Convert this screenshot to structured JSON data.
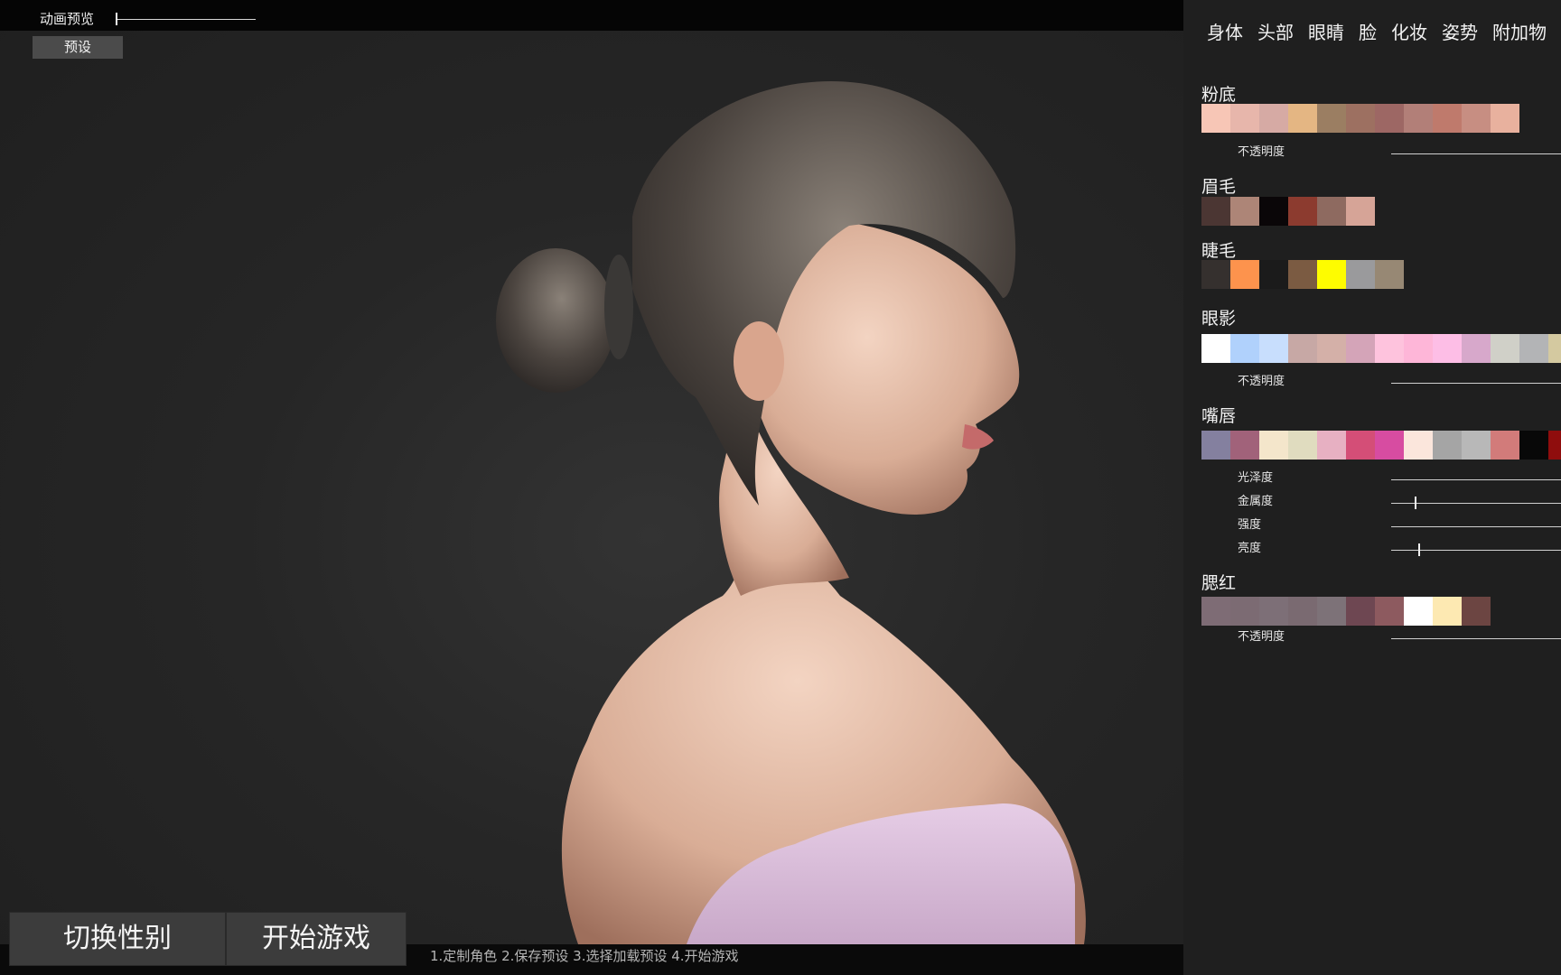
{
  "top_left": {
    "animation_preview_label": "动画预览",
    "preset_label": "预设"
  },
  "bottom": {
    "switch_gender_label": "切换性别",
    "start_game_label": "开始游戏",
    "hint": "1.定制角色 2.保存预设 3.选择加载预设 4.开始游戏"
  },
  "panel": {
    "tabs": [
      "身体",
      "头部",
      "眼睛",
      "脸",
      "化妆",
      "姿势",
      "附加物"
    ],
    "foundation": {
      "title": "粉底",
      "colors": [
        "#f7c6b6",
        "#e7b6ab",
        "#d6aaa4",
        "#e4b683",
        "#9b7e62",
        "#9d7061",
        "#9d6764",
        "#b27f78",
        "#bf7a6c",
        "#c78e82",
        "#e8b19e"
      ],
      "opacity_label": "不透明度",
      "opacity_value": 0
    },
    "eyebrows": {
      "title": "眉毛",
      "colors": [
        "#4b3633",
        "#ad8577",
        "#0a0608",
        "#8c3b2f",
        "#8e6a60",
        "#d6a497"
      ]
    },
    "eyelashes": {
      "title": "睫毛",
      "colors": [
        "#35302e",
        "#fd934d",
        "#1b1b1b",
        "#7b5b42",
        "#fefc00",
        "#9a9a9c",
        "#978874"
      ]
    },
    "eyeshadow": {
      "title": "眼影",
      "colors": [
        "#ffffff",
        "#b0d1fc",
        "#c8defd",
        "#c7a8a5",
        "#d4b0a8",
        "#d4a4b8",
        "#fec3dd",
        "#feb6d8",
        "#fdbee6",
        "#d7a8cb",
        "#d0d0c8",
        "#b3b4b6",
        "#d4c9a0"
      ],
      "opacity_label": "不透明度",
      "opacity_value": 0
    },
    "lips": {
      "title": "嘴唇",
      "colors": [
        "#84809f",
        "#a1627a",
        "#f4e6cb",
        "#e0dcbf",
        "#e7b0c2",
        "#d44e77",
        "#d74ca1",
        "#fbe6dc",
        "#a5a5a5",
        "#b8b8b8",
        "#d27b7a",
        "#080808",
        "#8f0d0d"
      ],
      "sliders": [
        {
          "label": "光泽度",
          "value": 0
        },
        {
          "label": "金属度",
          "value": 0.14
        },
        {
          "label": "强度",
          "value": 0
        },
        {
          "label": "亮度",
          "value": 0.16
        }
      ]
    },
    "blush": {
      "title": "腮红",
      "colors": [
        "#7e6c75",
        "#7c6b73",
        "#7d6f77",
        "#7a6a71",
        "#7d7278",
        "#6e4752",
        "#8d5a5f",
        "#ffffff",
        "#fde9b2",
        "#6c4542"
      ],
      "opacity_label": "不透明度",
      "opacity_value": 0
    }
  },
  "viewport": {
    "animation_preview_value": 0
  }
}
